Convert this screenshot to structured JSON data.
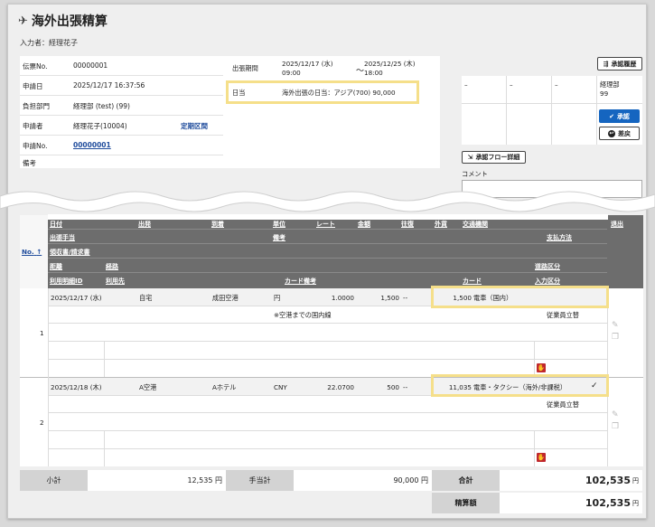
{
  "header": {
    "title": "海外出張精算",
    "author_label": "入力者：経理花子"
  },
  "info": [
    {
      "key": "伝票No.",
      "value": "00000001"
    },
    {
      "key": "申請日",
      "value": "2025/12/17 16:37:56"
    },
    {
      "key": "負担部門",
      "value": "経理部 (test) (99)"
    },
    {
      "key": "申請者",
      "value": "経理花子(10004)",
      "link": "定期区間"
    },
    {
      "key": "申請No.",
      "value": "00000001"
    },
    {
      "key": "備考",
      "value": ""
    }
  ],
  "period": {
    "label": "出張期間",
    "start": "2025/12/17 (水)",
    "start_time": "09:00",
    "sep": "～",
    "end": "2025/12/25 (木)",
    "end_time": "18:00"
  },
  "allowance": {
    "label": "日当",
    "value": "海外出張の日当：アジア(700)  90,000"
  },
  "approval": {
    "history_button": "承認履歴",
    "cols": [
      "–",
      "–",
      "–"
    ],
    "dept": "経理部",
    "dept_code": "99",
    "approve_button": "承認",
    "reject_button": "差戻",
    "flow_button": "承認フロー詳細",
    "comment_label": "コメント"
  },
  "table": {
    "no_label": "No.",
    "header_row1": [
      "日付",
      "出発",
      "到着",
      "単位",
      "レート",
      "金額",
      "往復",
      "外貨",
      "交通機関",
      "退出"
    ],
    "header_row2": [
      "出張手当",
      "備考",
      "支払方法"
    ],
    "header_row3": [
      "領収書/請求書"
    ],
    "header_row4": [
      "距離",
      "経路",
      "道路区分"
    ],
    "header_row5": [
      "利用明細ID",
      "利用先",
      "カード備考",
      "カード",
      "入力区分"
    ],
    "rows": [
      {
        "no": "1",
        "date": "2025/12/17 (水)",
        "from": "自宅",
        "to": "成田空港",
        "unit": "円",
        "rate": "1.0000",
        "amount": "1,500",
        "round": "--",
        "total": "1,500",
        "transport": "電車（国内）",
        "check": "",
        "note": "※空港までの国内線",
        "payment": "従業員立替"
      },
      {
        "no": "2",
        "date": "2025/12/18 (木)",
        "from": "A空港",
        "to": "Aホテル",
        "unit": "CNY",
        "rate": "22.0700",
        "amount": "500",
        "round": "--",
        "total": "11,035",
        "transport": "電車・タクシー（海外/非課税）",
        "check": "✓",
        "note": "",
        "payment": "従業員立替"
      }
    ]
  },
  "totals": {
    "subtotal_label": "小計",
    "subtotal": "12,535 円",
    "allowance_label": "手当計",
    "allowance": "90,000 円",
    "total_label": "合計",
    "total": "102,535",
    "total_unit": "円",
    "settle_label": "精算額",
    "settle": "102,535",
    "settle_unit": "円"
  }
}
